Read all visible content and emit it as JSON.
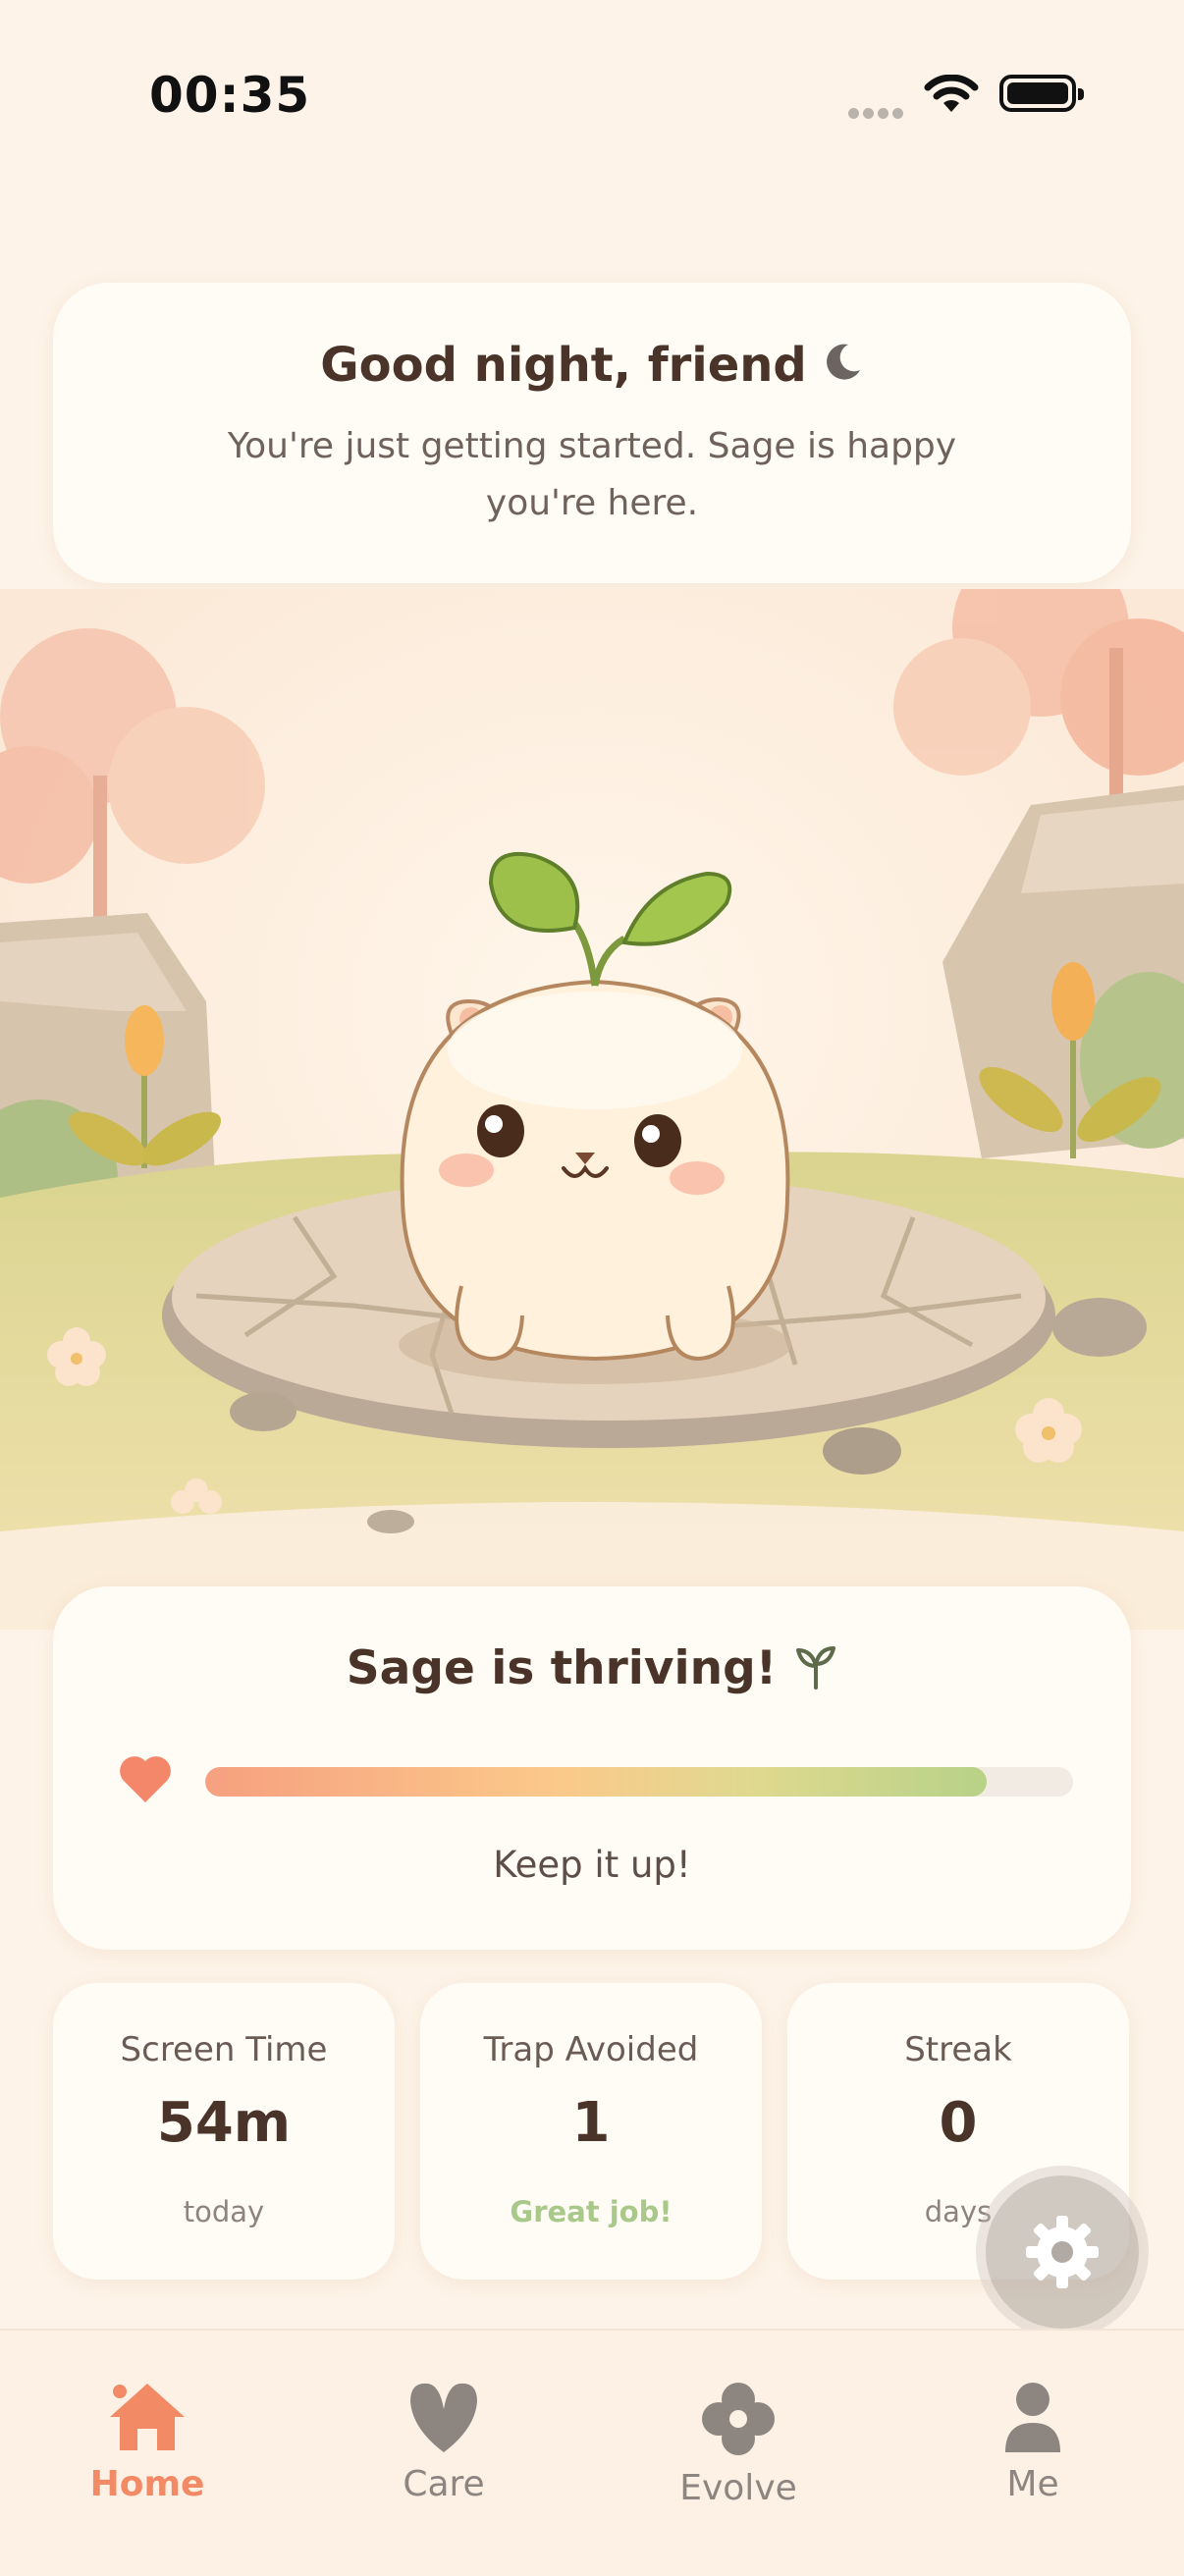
{
  "status_bar": {
    "time": "00:35"
  },
  "greeting": {
    "title": "Good night, friend",
    "subtitle": "You're just getting started. Sage is happy you're here."
  },
  "pet": {
    "name": "Sage",
    "scene_icon": "pet-meadow-illustration"
  },
  "mood": {
    "title": "Sage is thriving!",
    "health_level": 0.9,
    "caption": "Keep it up!"
  },
  "stats": [
    {
      "label": "Screen Time",
      "value": "54m",
      "note": "today"
    },
    {
      "label": "Trap Avoided",
      "value": "1",
      "note": "Great job!"
    },
    {
      "label": "Streak",
      "value": "0",
      "note": "days"
    }
  ],
  "tabs": [
    {
      "label": "Home",
      "icon": "home-icon",
      "active": true
    },
    {
      "label": "Care",
      "icon": "heart-icon",
      "active": false
    },
    {
      "label": "Evolve",
      "icon": "flower-icon",
      "active": false
    },
    {
      "label": "Me",
      "icon": "person-icon",
      "active": false
    }
  ],
  "colors": {
    "accent": "#f28a66",
    "background": "#fdf3e8",
    "card": "#fffbf5",
    "positive": "#a9c98a"
  }
}
